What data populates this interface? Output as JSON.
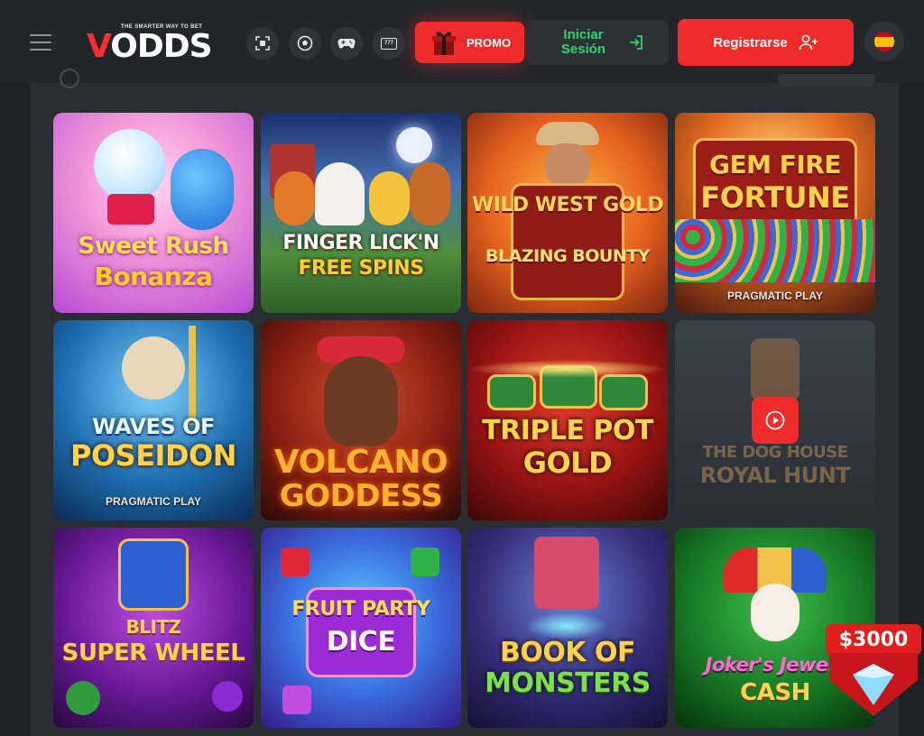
{
  "header": {
    "brand": {
      "logo_text_v": "V",
      "logo_text_rest": "ODDS",
      "tagline": "THE SMARTER WAY TO BET"
    },
    "icons": [
      "scan-icon",
      "soccer-ball-icon",
      "gamepad-icon",
      "slot-777-icon"
    ],
    "slot_icon_text": "777",
    "promo_label": "PROMO",
    "login_label": "Iniciar Sesión",
    "register_label": "Registrarse"
  },
  "games": [
    {
      "title_line1": "Sweet Rush",
      "title_line2": "Bonanza",
      "provider": ""
    },
    {
      "title_line1": "FINGER LICK'N",
      "title_line2": "FREE SPINS",
      "provider": ""
    },
    {
      "title_line1": "WILD WEST GOLD",
      "title_line2": "BLAZING BOUNTY",
      "provider": ""
    },
    {
      "title_line1": "GEM FIRE",
      "title_line2": "FORTUNE",
      "provider": "PRAGMATIC PLAY"
    },
    {
      "title_line1": "WAVES OF",
      "title_line2": "POSEIDON",
      "provider": "PRAGMATIC PLAY"
    },
    {
      "title_line1": "VOLCANO",
      "title_line2": "GODDESS",
      "provider": ""
    },
    {
      "title_line1": "TRIPLE POT",
      "title_line2": "GOLD",
      "provider": ""
    },
    {
      "title_line1": "THE DOG HOUSE",
      "title_line2": "ROYAL HUNT",
      "provider": ""
    },
    {
      "title_line1": "BLITZ",
      "title_line2": "SUPER WHEEL",
      "provider": ""
    },
    {
      "title_line1": "FRUIT PARTY",
      "title_line2": "DICE",
      "provider": ""
    },
    {
      "title_line1": "BOOK OF",
      "title_line2": "MONSTERS",
      "provider": ""
    },
    {
      "title_line1": "Joker's Jewels",
      "title_line2": "CASH",
      "provider": ""
    }
  ],
  "jackpot": {
    "amount": "$3000"
  },
  "colors": {
    "accent": "#ef2b2b",
    "login_text": "#2fd36a",
    "background": "#1e2126",
    "panel": "#2a2e33"
  }
}
